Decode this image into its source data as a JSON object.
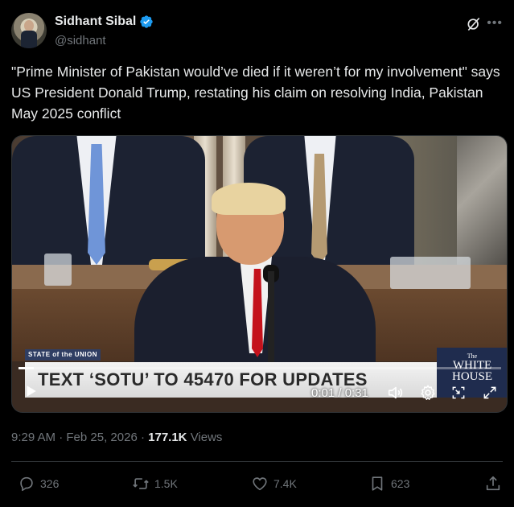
{
  "author": {
    "name": "Sidhant Sibal",
    "handle": "@sidhant",
    "verified": true
  },
  "tweet": {
    "text": "\"Prime Minister of Pakistan would’ve died if it weren’t for my involvement\" says US President Donald Trump, restating his claim on resolving India, Pakistan May 2025 conflict"
  },
  "video": {
    "tag": "STATE of the UNION",
    "lower_third": "TEXT ‘SOTU’ TO 45470 FOR UPDATES",
    "network_the": "The",
    "network_name": "WHITE HOUSE",
    "time_display": "0:01 / 0:31",
    "progress_fraction": 0.032
  },
  "meta": {
    "time": "9:29 AM",
    "separator": "·",
    "date": "Feb 25, 2026",
    "views_count": "177.1K",
    "views_label": "Views"
  },
  "actions": {
    "replies": "326",
    "reposts": "1.5K",
    "likes": "7.4K",
    "bookmarks": "623"
  },
  "colors": {
    "background": "#000000",
    "text": "#e7e9ea",
    "secondary": "#71767b",
    "verified": "#1d9bf0",
    "divider": "#2f3336"
  },
  "icons": [
    "verified-badge-icon",
    "grok-icon",
    "more-icon",
    "play-icon",
    "volume-icon",
    "settings-icon",
    "pip-icon",
    "fullscreen-icon",
    "reply-icon",
    "repost-icon",
    "like-icon",
    "bookmark-icon",
    "share-icon"
  ]
}
